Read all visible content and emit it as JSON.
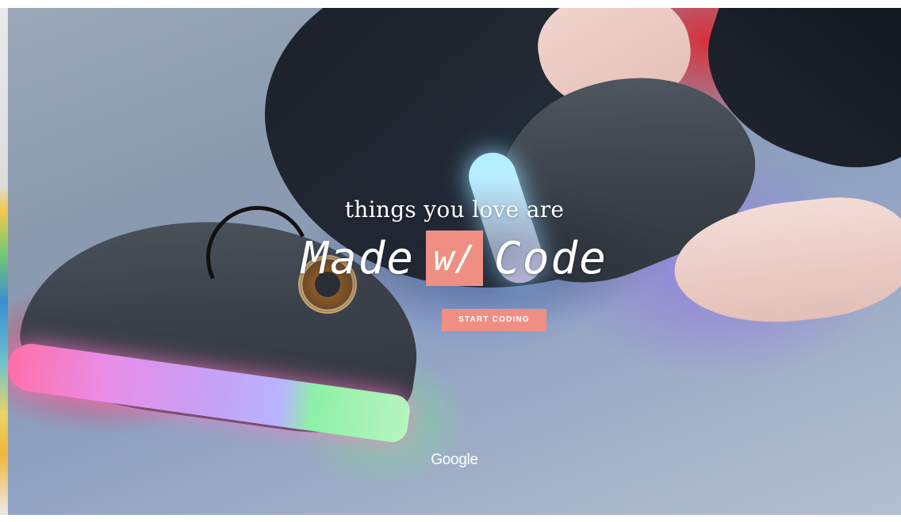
{
  "hero": {
    "tagline": "things you love are",
    "logo": {
      "word_left": "Made",
      "word_middle": "w/",
      "word_right": "Code"
    },
    "cta_label": "START CODING",
    "footer_brand": "Google"
  },
  "colors": {
    "accent": "#ef8f83",
    "text": "#ffffff"
  },
  "icons": {
    "brand": "google-wordmark"
  }
}
